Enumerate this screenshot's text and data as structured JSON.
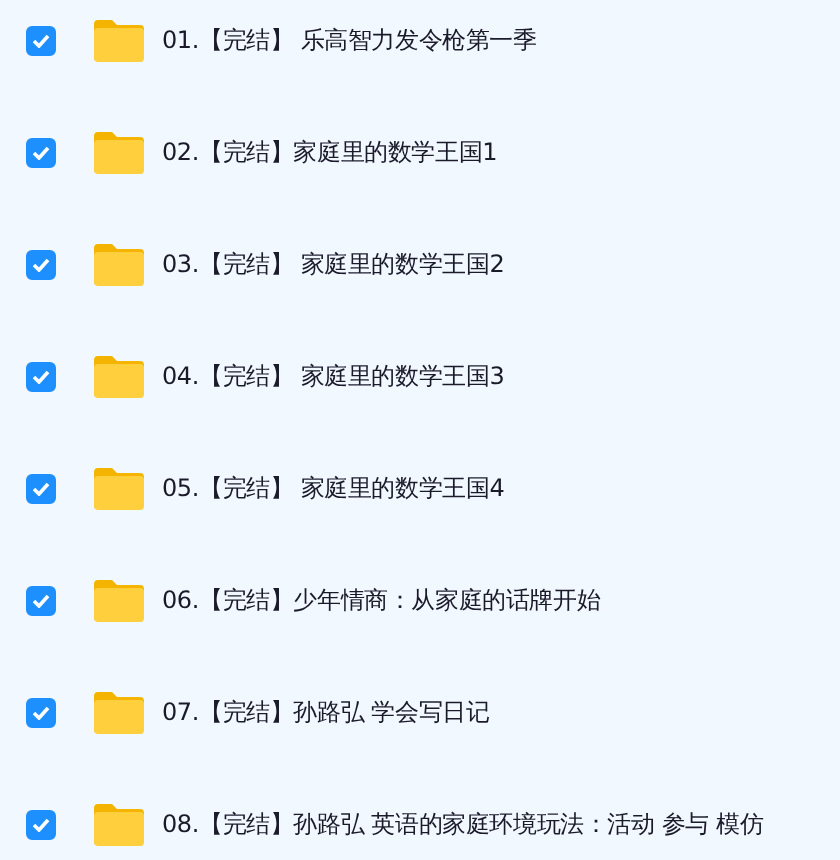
{
  "items": [
    {
      "name": "01.【完结】 乐高智力发令枪第一季",
      "checked": true
    },
    {
      "name": "02.【完结】家庭里的数学王国1",
      "checked": true
    },
    {
      "name": "03.【完结】 家庭里的数学王国2",
      "checked": true
    },
    {
      "name": "04.【完结】 家庭里的数学王国3",
      "checked": true
    },
    {
      "name": "05.【完结】 家庭里的数学王国4",
      "checked": true
    },
    {
      "name": "06.【完结】少年情商：从家庭的话牌开始",
      "checked": true
    },
    {
      "name": "07.【完结】孙路弘 学会写日记",
      "checked": true
    },
    {
      "name": "08.【完结】孙路弘 英语的家庭环境玩法：活动 参与 模仿",
      "checked": true
    }
  ]
}
